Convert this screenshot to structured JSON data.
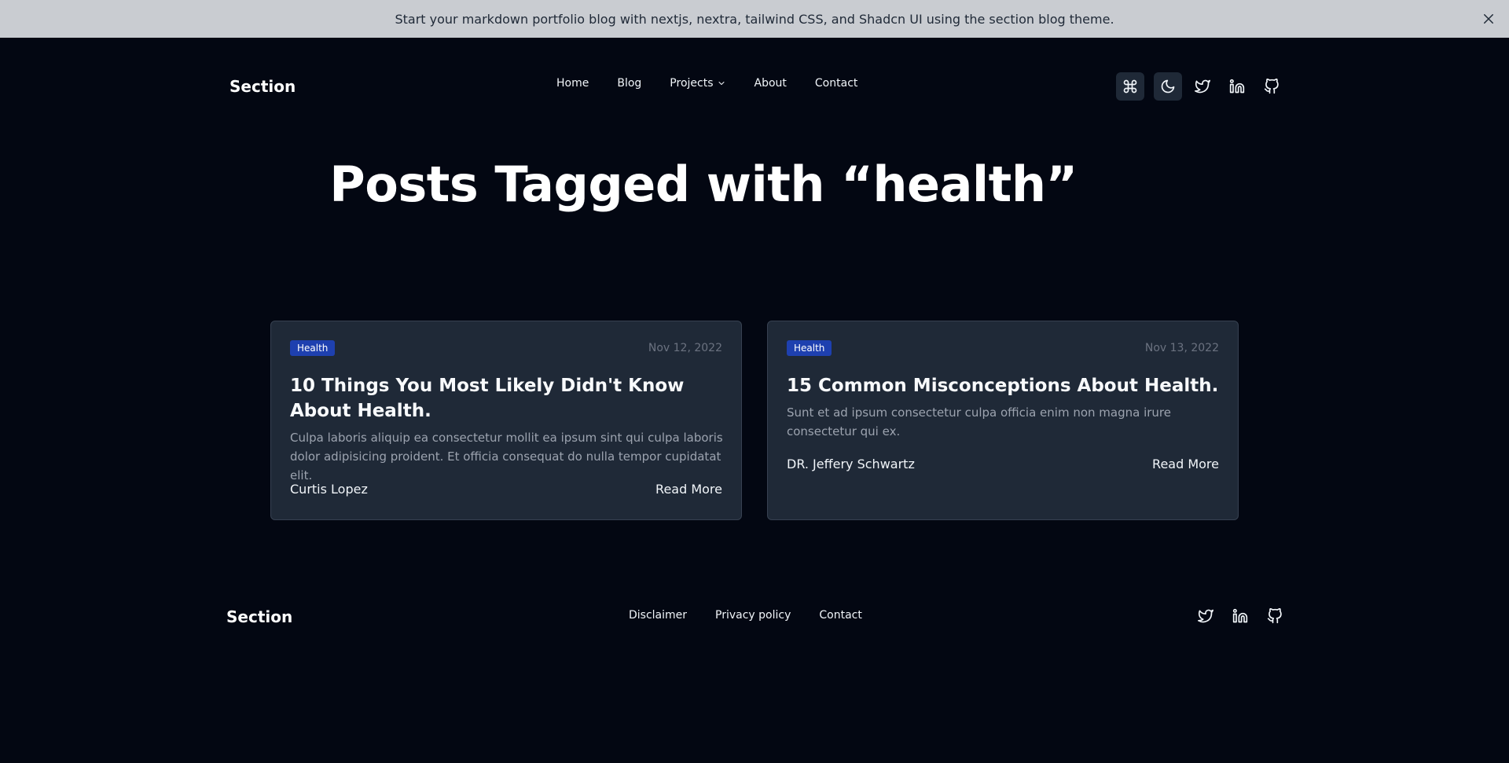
{
  "banner": {
    "text": "Start your markdown portfolio blog with nextjs, nextra, tailwind CSS, and Shadcn UI using  the section blog theme.",
    "close_icon": "close-icon"
  },
  "header": {
    "logo": "Section",
    "nav": [
      {
        "label": "Home"
      },
      {
        "label": "Blog"
      },
      {
        "label": "Projects",
        "icon": "chevron-down-icon"
      },
      {
        "label": "About"
      },
      {
        "label": "Contact"
      }
    ],
    "icons": [
      "command-icon",
      "moon-icon",
      "twitter-icon",
      "linkedin-icon",
      "github-icon"
    ]
  },
  "main": {
    "title": "Posts Tagged with “health”",
    "posts": [
      {
        "tag": "Health",
        "date": "Nov 12, 2022",
        "title": "10 Things You Most Likely Didn't Know About Health.",
        "description": "Culpa laboris aliquip ea consectetur mollit ea ipsum sint qui culpa laboris dolor adipisicing proident. Et officia consequat do nulla tempor cupidatat elit.",
        "author": "Curtis Lopez",
        "read_more": "Read More"
      },
      {
        "tag": "Health",
        "date": "Nov 13, 2022",
        "title": "15 Common Misconceptions About Health.",
        "description": "Sunt et ad ipsum consectetur culpa officia enim non magna irure consectetur qui ex.",
        "author": "DR. Jeffery Schwartz",
        "read_more": "Read More"
      }
    ]
  },
  "footer": {
    "logo": "Section",
    "links": [
      {
        "label": "Disclaimer"
      },
      {
        "label": "Privacy policy"
      },
      {
        "label": "Contact"
      }
    ],
    "icons": [
      "twitter-icon",
      "linkedin-icon",
      "github-icon"
    ]
  },
  "colors": {
    "background": "#030712",
    "banner": "#c9ccd1",
    "card": "#1f2937",
    "badge": "#1e40af"
  }
}
